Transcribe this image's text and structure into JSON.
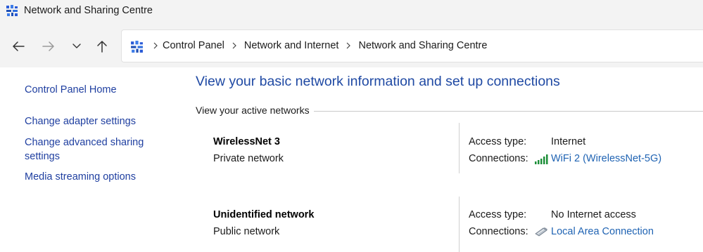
{
  "window": {
    "title": "Network and Sharing Centre"
  },
  "breadcrumb": {
    "items": [
      "Control Panel",
      "Network and Internet",
      "Network and Sharing Centre"
    ]
  },
  "sidebar": {
    "items": [
      {
        "label": "Control Panel Home"
      },
      {
        "label": "Change adapter settings"
      },
      {
        "label": "Change advanced sharing settings",
        "lines": [
          "Change advanced sharing",
          "settings"
        ]
      },
      {
        "label": "Media streaming options"
      }
    ]
  },
  "main": {
    "title": "View your basic network information and set up connections",
    "section_label": "View your active networks",
    "networks": [
      {
        "name": "WirelessNet 3",
        "type": "Private network",
        "access_type_label": "Access type:",
        "access_type": "Internet",
        "connections_label": "Connections:",
        "connection": "WiFi 2 (WirelessNet-5G)",
        "connection_icon": "wifi-signal-icon"
      },
      {
        "name": "Unidentified network",
        "type": "Public network",
        "access_type_label": "Access type:",
        "access_type": "No Internet access",
        "connections_label": "Connections:",
        "connection": "Local Area Connection",
        "connection_icon": "ethernet-cable-icon"
      }
    ]
  },
  "colors": {
    "link": "#1f3fa0",
    "title": "#1f49a3",
    "connection_link": "#1f63b3",
    "chrome": "#f3f3f3"
  }
}
